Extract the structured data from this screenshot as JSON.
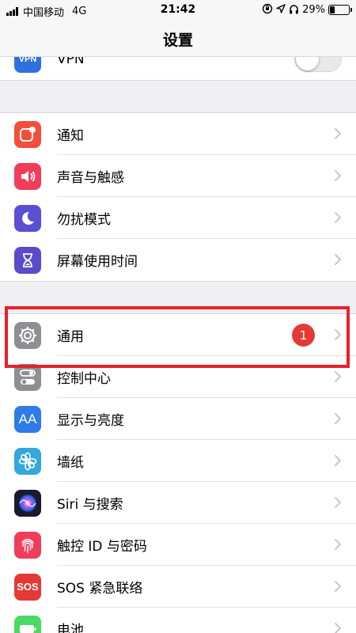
{
  "status_bar": {
    "carrier": "中国移动",
    "network": "4G",
    "time": "21:42",
    "battery": "29%",
    "battery_level": 0.29,
    "icons": [
      "signal-icon",
      "orientation-lock-icon",
      "location-icon",
      "headphones-icon",
      "battery-icon"
    ]
  },
  "nav": {
    "title": "设置"
  },
  "groups": [
    {
      "rows": [
        {
          "label": "VPN",
          "icon": "vpn-icon",
          "icon_color": "#2f6fe0",
          "accessory": "toggle",
          "toggle_on": false
        }
      ]
    },
    {
      "rows": [
        {
          "label": "通知",
          "icon": "notifications-icon",
          "icon_color": "#f24e3b"
        },
        {
          "label": "声音与触感",
          "icon": "sounds-icon",
          "icon_color": "#f03d5a"
        },
        {
          "label": "勿扰模式",
          "icon": "do-not-disturb-icon",
          "icon_color": "#5b4fd3"
        },
        {
          "label": "屏幕使用时间",
          "icon": "screen-time-icon",
          "icon_color": "#5a4bc8"
        }
      ]
    },
    {
      "rows": [
        {
          "label": "通用",
          "icon": "general-gear-icon",
          "icon_color": "#8e8e93",
          "badge": "1",
          "highlighted": true
        },
        {
          "label": "控制中心",
          "icon": "control-center-icon",
          "icon_color": "#8e8e93"
        },
        {
          "label": "显示与亮度",
          "icon": "display-brightness-icon",
          "icon_color": "#2f7be8",
          "icon_text": "AA"
        },
        {
          "label": "墙纸",
          "icon": "wallpaper-icon",
          "icon_color": "#35a7dc"
        },
        {
          "label": "Siri 与搜索",
          "icon": "siri-icon",
          "icon_color": "#1a1a2e"
        },
        {
          "label": "触控 ID 与密码",
          "icon": "touch-id-icon",
          "icon_color": "#f03d5a"
        },
        {
          "label": "SOS 紧急联络",
          "icon": "sos-icon",
          "icon_color": "#e53935",
          "icon_text": "SOS"
        },
        {
          "label": "电池",
          "icon": "battery-settings-icon",
          "icon_color": "#4cd964"
        }
      ]
    }
  ]
}
